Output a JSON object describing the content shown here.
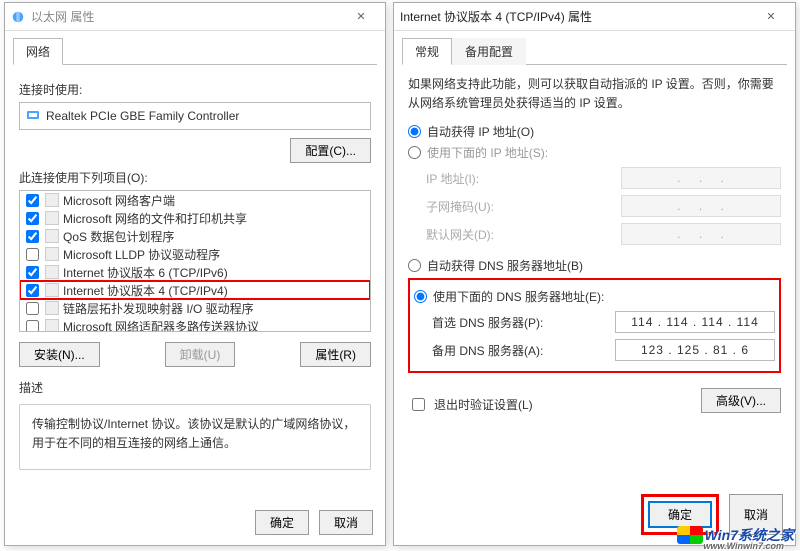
{
  "left": {
    "title": "以太网 属性",
    "tab": "网络",
    "connect_label": "连接时使用:",
    "adapter": "Realtek PCIe GBE Family Controller",
    "config_btn": "配置(C)...",
    "items_label": "此连接使用下列项目(O):",
    "items": [
      {
        "checked": true,
        "name": "Microsoft 网络客户端"
      },
      {
        "checked": true,
        "name": "Microsoft 网络的文件和打印机共享"
      },
      {
        "checked": true,
        "name": "QoS 数据包计划程序"
      },
      {
        "checked": false,
        "name": "Microsoft LLDP 协议驱动程序"
      },
      {
        "checked": true,
        "name": "Internet 协议版本 6 (TCP/IPv6)"
      },
      {
        "checked": true,
        "name": "Internet 协议版本 4 (TCP/IPv4)",
        "highlight": true
      },
      {
        "checked": false,
        "name": "链路层拓扑发现映射器 I/O 驱动程序"
      },
      {
        "checked": false,
        "name": "Microsoft 网络适配器多路传送器协议"
      }
    ],
    "install_btn": "安装(N)...",
    "uninstall_btn": "卸载(U)",
    "props_btn": "属性(R)",
    "desc_title": "描述",
    "desc": "传输控制协议/Internet 协议。该协议是默认的广域网络协议，用于在不同的相互连接的网络上通信。",
    "ok": "确定",
    "cancel": "取消"
  },
  "right": {
    "title": "Internet 协议版本 4 (TCP/IPv4) 属性",
    "tabs": {
      "general": "常规",
      "alt": "备用配置"
    },
    "intro": "如果网络支持此功能，则可以获取自动指派的 IP 设置。否则，你需要从网络系统管理员处获得适当的 IP 设置。",
    "ip_auto": "自动获得 IP 地址(O)",
    "ip_manual": "使用下面的 IP 地址(S):",
    "ip_addr_lbl": "IP 地址(I):",
    "subnet_lbl": "子网掩码(U):",
    "gateway_lbl": "默认网关(D):",
    "dns_auto": "自动获得 DNS 服务器地址(B)",
    "dns_manual": "使用下面的 DNS 服务器地址(E):",
    "dns_pref_lbl": "首选 DNS 服务器(P):",
    "dns_alt_lbl": "备用 DNS 服务器(A):",
    "dns_pref_val": "114 . 114 . 114 . 114",
    "dns_alt_val": "123 . 125 .  81  .    6",
    "validate": "退出时验证设置(L)",
    "advanced": "高级(V)...",
    "ok": "确定",
    "cancel": "取消"
  },
  "watermark": {
    "brand": "Win7系统之家",
    "url": "www.Winwin7.com"
  }
}
